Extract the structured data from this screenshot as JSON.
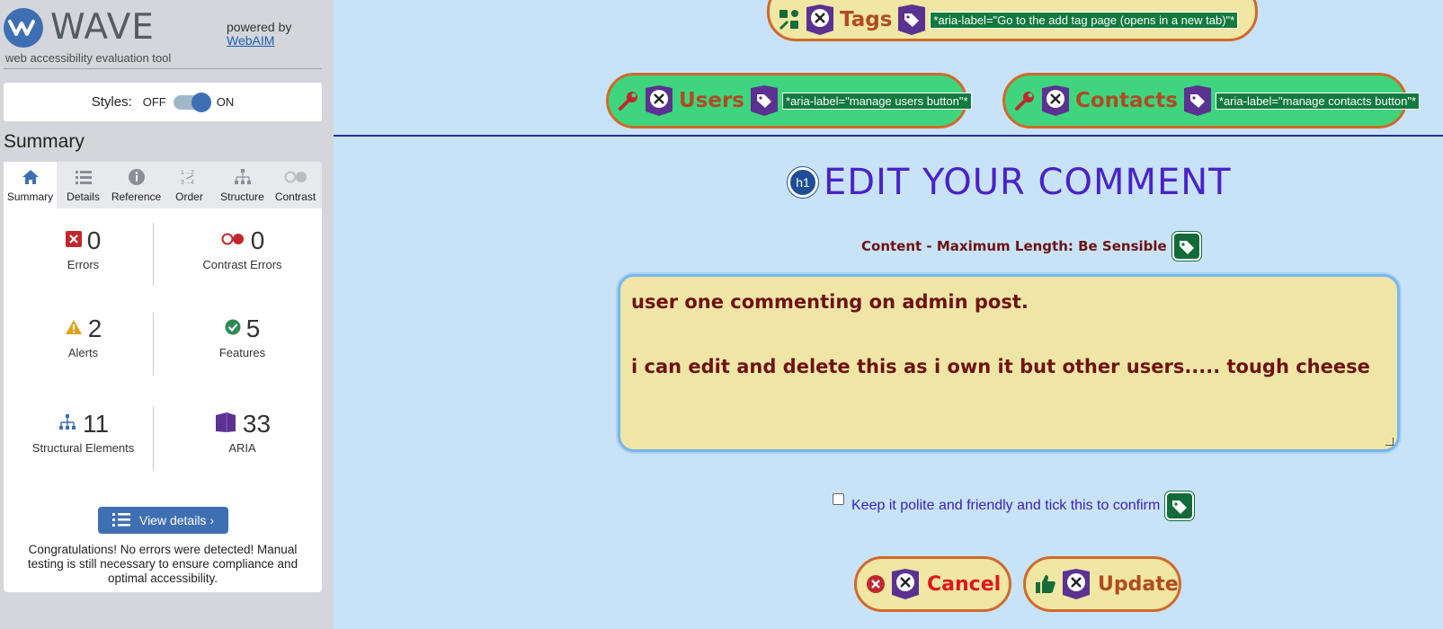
{
  "wave": {
    "logo_text": "WAVE",
    "tagline": "web accessibility evaluation tool",
    "powered_by": "powered by",
    "powered_link": "WebAIM",
    "styles_label": "Styles:",
    "styles_off": "OFF",
    "styles_on": "ON",
    "summary_heading": "Summary",
    "tabs": [
      {
        "label": "Summary",
        "icon": "home-icon"
      },
      {
        "label": "Details",
        "icon": "list-icon"
      },
      {
        "label": "Reference",
        "icon": "info-icon"
      },
      {
        "label": "Order",
        "icon": "order-icon"
      },
      {
        "label": "Structure",
        "icon": "structure-icon"
      },
      {
        "label": "Contrast",
        "icon": "contrast-icon"
      }
    ],
    "stats": [
      {
        "value": "0",
        "label": "Errors",
        "icon": "error-icon",
        "color": "#c0282e"
      },
      {
        "value": "0",
        "label": "Contrast Errors",
        "icon": "contrast-error-icon",
        "color": "#c0282e"
      },
      {
        "value": "2",
        "label": "Alerts",
        "icon": "alert-icon",
        "color": "#e0a21c"
      },
      {
        "value": "5",
        "label": "Features",
        "icon": "feature-icon",
        "color": "#2e8a55"
      },
      {
        "value": "11",
        "label": "Structural Elements",
        "icon": "structure-icon",
        "color": "#3f6fb3"
      },
      {
        "value": "33",
        "label": "ARIA",
        "icon": "aria-icon",
        "color": "#5b3191"
      }
    ],
    "view_details": "View details ›",
    "congrats": "Congratulations! No errors were detected! Manual testing is still necessary to ensure compliance and optimal accessibility."
  },
  "page": {
    "tags_button": "Tags",
    "tags_aria": "*aria-label=\"Go to the add tag page (opens in a new tab)\"*",
    "users_button": "Users",
    "users_aria": "*aria-label=\"manage users button\"*",
    "contacts_button": "Contacts",
    "contacts_aria": "*aria-label=\"manage contacts button\"*",
    "h1_badge": "h1",
    "heading": "EDIT YOUR COMMENT",
    "content_label": "Content - Maximum Length: Be Sensible",
    "comment_line1": "user one commenting on admin post.",
    "comment_line2": "i can edit and delete this as i own it but other users..... tough cheese",
    "confirm_label": "Keep it polite and friendly and tick this to confirm",
    "cancel_button": "Cancel",
    "update_button": "Update"
  },
  "colors": {
    "accent": "#3f6fb3",
    "page_bg": "#c8e3f8",
    "pill_green": "#3ed57e",
    "pill_yellow": "#efe7a3",
    "pill_border": "#d0692c",
    "heading": "#4a22c8",
    "cancel_text": "#e0141c",
    "update_text": "#b04a24"
  }
}
